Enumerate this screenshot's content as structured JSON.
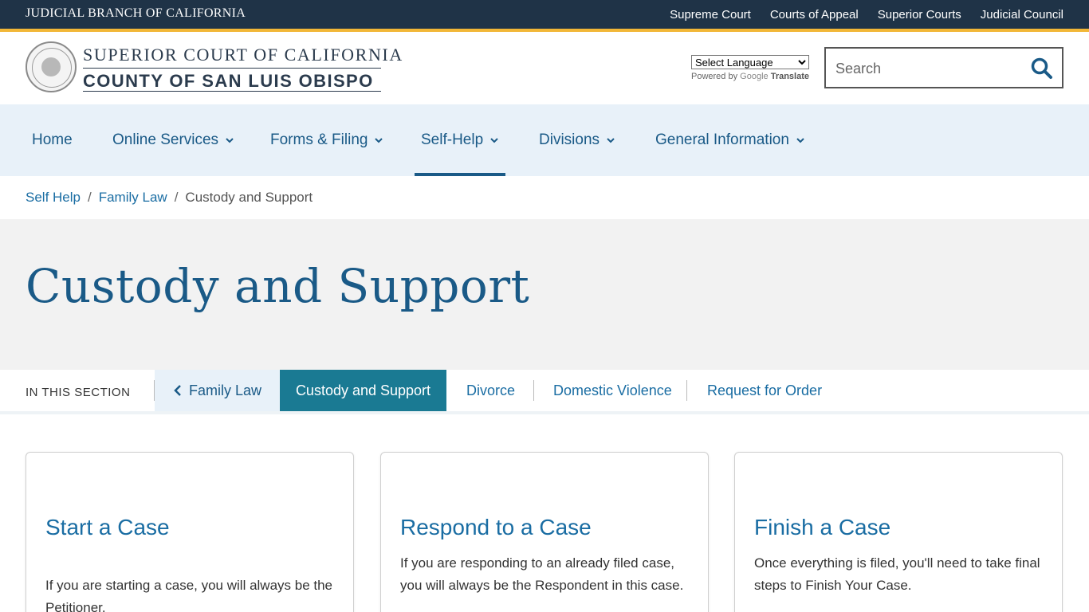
{
  "topbar": {
    "branch_name": "JUDICIAL BRANCH OF CALIFORNIA",
    "links": [
      "Supreme Court",
      "Courts of Appeal",
      "Superior Courts",
      "Judicial Council"
    ]
  },
  "header": {
    "court_line1": "SUPERIOR COURT OF CALIFORNIA",
    "court_line2": "COUNTY OF SAN LUIS OBISPO",
    "language_select": "Select Language",
    "powered_by": "Powered by",
    "google": "Google",
    "translate": "Translate",
    "search_placeholder": "Search"
  },
  "nav": {
    "items": [
      {
        "label": "Home"
      },
      {
        "label": "Online Services"
      },
      {
        "label": "Forms & Filing"
      },
      {
        "label": "Self-Help"
      },
      {
        "label": "Divisions"
      },
      {
        "label": "General Information"
      }
    ]
  },
  "breadcrumb": {
    "items": [
      "Self Help",
      "Family Law",
      "Custody and Support"
    ],
    "separator": "/"
  },
  "hero": {
    "title": "Custody and Support"
  },
  "section_nav": {
    "label": "IN THIS SECTION",
    "back": "Family Law",
    "active": "Custody and Support",
    "links": [
      "Divorce",
      "Domestic Violence",
      "Request for Order"
    ]
  },
  "cards": [
    {
      "title": "Start a Case",
      "text": "If you are starting a case, you will always be the Petitioner."
    },
    {
      "title": "Respond to a Case",
      "text": "If you are responding to an already filed case, you will always be the Respondent in this case."
    },
    {
      "title": "Finish a Case",
      "text": "Once everything is filed, you'll need to take final steps to Finish Your Case."
    }
  ],
  "colors": {
    "topbar": "#1f3347",
    "gold_accent": "#f2b737",
    "nav_bg": "#e8f1f9",
    "primary_blue": "#1a5a87",
    "active_teal": "#1a7a93"
  }
}
